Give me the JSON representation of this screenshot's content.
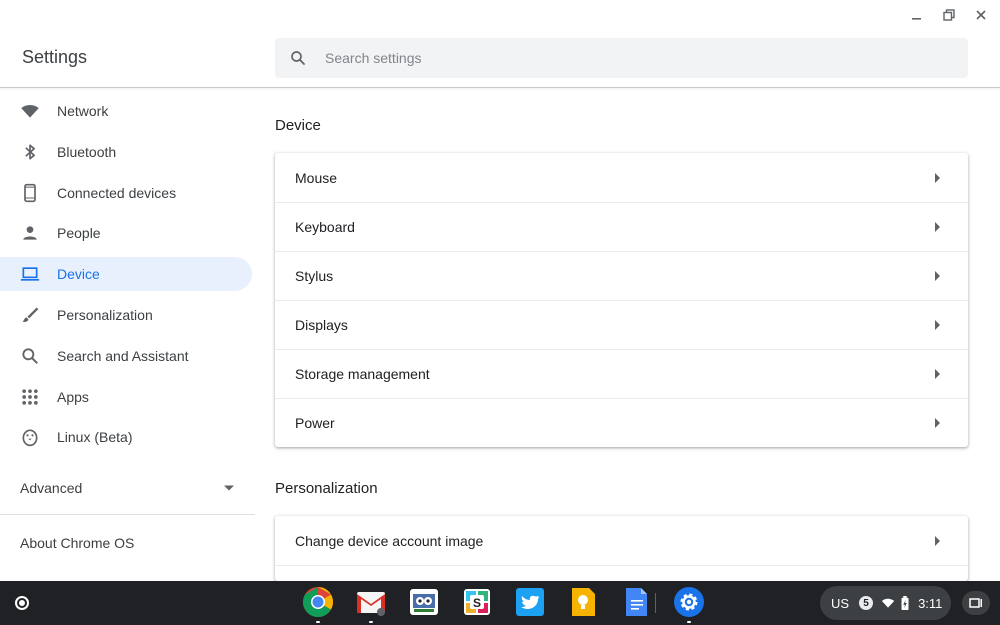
{
  "window": {
    "title": "Settings",
    "controls": [
      "minimize-icon",
      "restore-icon",
      "close-icon"
    ]
  },
  "search": {
    "placeholder": "Search settings",
    "value": ""
  },
  "sidebar": {
    "items": [
      {
        "label": "Network",
        "icon": "wifi-icon"
      },
      {
        "label": "Bluetooth",
        "icon": "bluetooth-icon"
      },
      {
        "label": "Connected devices",
        "icon": "phone-icon"
      },
      {
        "label": "People",
        "icon": "person-icon"
      },
      {
        "label": "Device",
        "icon": "laptop-icon",
        "active": true
      },
      {
        "label": "Personalization",
        "icon": "brush-icon"
      },
      {
        "label": "Search and Assistant",
        "icon": "search-icon"
      },
      {
        "label": "Apps",
        "icon": "apps-grid-icon"
      },
      {
        "label": "Linux (Beta)",
        "icon": "penguin-icon"
      }
    ],
    "advanced_label": "Advanced",
    "about_label": "About Chrome OS"
  },
  "main": {
    "device": {
      "title": "Device",
      "rows": [
        "Mouse",
        "Keyboard",
        "Stylus",
        "Displays",
        "Storage management",
        "Power"
      ]
    },
    "personalization": {
      "title": "Personalization",
      "rows": [
        "Change device account image"
      ]
    }
  },
  "shelf": {
    "apps": [
      "chrome-icon",
      "gmail-icon",
      "game-app-icon",
      "slides-app-icon",
      "twitter-icon",
      "keep-icon",
      "docs-icon",
      "settings-icon"
    ],
    "tray": {
      "language": "US",
      "notification_count": "5",
      "time": "3:11"
    }
  },
  "colors": {
    "accent": "#1a73e8",
    "active_bg": "#e8f0fe",
    "shelf_bg": "#202124"
  }
}
